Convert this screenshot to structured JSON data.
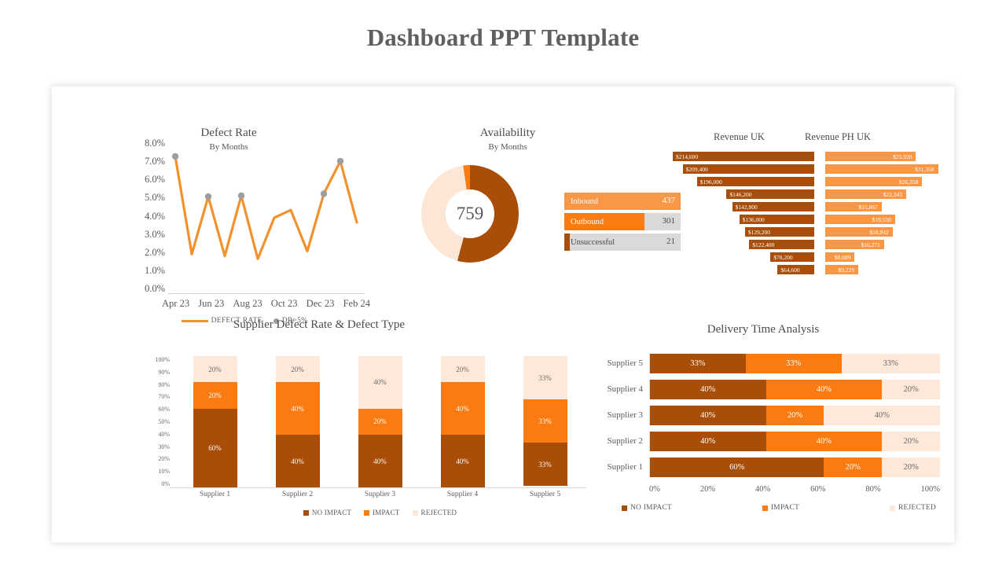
{
  "page": {
    "title": "Dashboard PPT Template"
  },
  "colors": {
    "dark_orange": "#a84e08",
    "orange": "#f97b11",
    "light_orange": "#f99746",
    "pale_orange": "#fde8d9",
    "grey": "#d9d9d9",
    "title_grey": "#5f5f5f"
  },
  "defect_rate": {
    "title": "Defect Rate",
    "subtitle": "By Months",
    "legend": [
      {
        "label": "DEFECT RATE",
        "type": "line",
        "color": "#f2922f"
      },
      {
        "label": "DR>5%",
        "type": "dot",
        "color": "#9e9e9e"
      }
    ],
    "chart_data": {
      "type": "line",
      "title": "Defect Rate",
      "subtitle": "By Months",
      "xlabel": "",
      "ylabel": "",
      "ylim": [
        0,
        8
      ],
      "yticks": [
        "0.0%",
        "1.0%",
        "2.0%",
        "3.0%",
        "4.0%",
        "5.0%",
        "6.0%",
        "7.0%",
        "8.0%"
      ],
      "xticks": [
        "Apr 23",
        "Jun 23",
        "Aug 23",
        "Oct 23",
        "Dec 23",
        "Feb 24"
      ],
      "x": [
        "Apr 23",
        "May 23",
        "Jun 23",
        "Jul 23",
        "Aug 23",
        "Sep 23",
        "Oct 23",
        "Nov 23",
        "Dec 23",
        "Jan 24",
        "Feb 24",
        "Mar 24"
      ],
      "series": [
        {
          "name": "DEFECT RATE",
          "color": "#f2922f",
          "values": [
            7.1,
            2.0,
            5.0,
            1.9,
            5.05,
            1.75,
            3.9,
            4.3,
            2.15,
            5.15,
            6.85,
            3.65
          ]
        },
        {
          "name": "DR>5%",
          "color": "#9e9e9e",
          "type": "marker",
          "points": [
            {
              "x": "Apr 23",
              "y": 7.1
            },
            {
              "x": "Jun 23",
              "y": 5.0
            },
            {
              "x": "Aug 23",
              "y": 5.05
            },
            {
              "x": "Jan 24",
              "y": 5.15
            },
            {
              "x": "Feb 24",
              "y": 6.85
            }
          ]
        }
      ],
      "grid": false,
      "legend_position": "bottom"
    }
  },
  "availability": {
    "title": "Availability",
    "subtitle": "By Months",
    "center_value": "759",
    "chart_data": {
      "type": "pie",
      "title": "Availability",
      "subtitle": "By Months",
      "center_label": "759",
      "labels": [
        "Inbound",
        "Outbound",
        "Unsuccessful"
      ],
      "values": [
        437,
        301,
        21
      ],
      "colors": [
        "#fce6d6",
        "#f97b11",
        "#a84e08"
      ],
      "legend_position": "right"
    },
    "legend": [
      {
        "label": "Inbound",
        "value": "437",
        "color": "#f99746",
        "fill_pct": 100,
        "text_on_fill": true
      },
      {
        "label": "Outbound",
        "value": "301",
        "color": "#f97b11",
        "fill_pct": 69,
        "text_on_fill": false
      },
      {
        "label": "Unsuccessful",
        "value": "21",
        "color": "#a84e08",
        "fill_pct": 5,
        "text_on_fill": false
      }
    ]
  },
  "revenue": {
    "uk_title": "Revenue UK",
    "ph_title": "Revenue PH UK",
    "chart_data": [
      {
        "type": "bar",
        "title": "Revenue UK",
        "orientation": "horizontal",
        "color": "#a84e08",
        "categories": [
          "1",
          "2",
          "3",
          "4",
          "5",
          "6",
          "7",
          "8",
          "9",
          "10"
        ],
        "labels": [
          "$214,600",
          "$209,400",
          "$196,000",
          "$146,200",
          "$142,800",
          "$136,000",
          "$129,200",
          "$122,400",
          "$78,200",
          "$64,600"
        ],
        "values": [
          214600,
          209400,
          196000,
          146200,
          142800,
          136000,
          129200,
          122400,
          78200,
          64600
        ]
      },
      {
        "type": "bar",
        "title": "Revenue PH UK",
        "orientation": "horizontal",
        "color": "#f99746",
        "categories": [
          "1",
          "2",
          "3",
          "4",
          "5",
          "6",
          "7",
          "8",
          "9",
          "10"
        ],
        "labels": [
          "$25,928",
          "$31,358",
          "$26,358",
          "$22,343",
          "$15,867",
          "$19,550",
          "$18,842",
          "$16,271",
          "$8,689",
          "$9,229"
        ],
        "values": [
          25928,
          31358,
          26358,
          22343,
          15867,
          19550,
          18842,
          16271,
          8689,
          9229
        ]
      }
    ],
    "uk_rows": [
      {
        "label": "$214,600",
        "width_pct": 100
      },
      {
        "label": "$209,400",
        "width_pct": 93
      },
      {
        "label": "$196,000",
        "width_pct": 83
      },
      {
        "label": "$146,200",
        "width_pct": 62
      },
      {
        "label": "$142,800",
        "width_pct": 58
      },
      {
        "label": "$136,000",
        "width_pct": 53
      },
      {
        "label": "$129,200",
        "width_pct": 49
      },
      {
        "label": "$122,400",
        "width_pct": 46
      },
      {
        "label": "$78,200",
        "width_pct": 31
      },
      {
        "label": "$64,600",
        "width_pct": 26
      }
    ],
    "ph_rows": [
      {
        "label": "$25,928",
        "width_pct": 74
      },
      {
        "label": "$31,358",
        "width_pct": 92
      },
      {
        "label": "$26,358",
        "width_pct": 79
      },
      {
        "label": "$22,343",
        "width_pct": 66
      },
      {
        "label": "$15,867",
        "width_pct": 46
      },
      {
        "label": "$19,550",
        "width_pct": 57
      },
      {
        "label": "$18,842",
        "width_pct": 55
      },
      {
        "label": "$16,271",
        "width_pct": 48
      },
      {
        "label": "$8,689",
        "width_pct": 24
      },
      {
        "label": "$9,229",
        "width_pct": 27
      }
    ]
  },
  "supplier_defect": {
    "title": "Supplier Defect Rate & Defect Type",
    "yticks": [
      "100%",
      "90%",
      "80%",
      "70%",
      "60%",
      "50%",
      "40%",
      "30%",
      "20%",
      "10%",
      "0%"
    ],
    "legend": [
      {
        "label": "NO IMPACT",
        "color": "#a84e08"
      },
      {
        "label": "IMPACT",
        "color": "#f97b11"
      },
      {
        "label": "REJECTED",
        "color": "#fde8d9"
      }
    ],
    "chart_data": {
      "type": "bar",
      "title": "Supplier Defect Rate & Defect Type",
      "stacked": true,
      "orientation": "vertical",
      "categories": [
        "Supplier 1",
        "Supplier 2",
        "Supplier 3",
        "Supplier 4",
        "Supplier 5"
      ],
      "ylim": [
        0,
        100
      ],
      "yticks": [
        0,
        10,
        20,
        30,
        40,
        50,
        60,
        70,
        80,
        90,
        100
      ],
      "ylabel": "",
      "series": [
        {
          "name": "NO IMPACT",
          "color": "#a84e08",
          "values": [
            60,
            40,
            40,
            40,
            33
          ]
        },
        {
          "name": "IMPACT",
          "color": "#f97b11",
          "values": [
            20,
            40,
            20,
            40,
            33
          ]
        },
        {
          "name": "REJECTED",
          "color": "#fde8d9",
          "values": [
            20,
            20,
            40,
            20,
            33
          ]
        }
      ],
      "legend_position": "bottom"
    },
    "columns": [
      {
        "name": "Supplier 1",
        "rejected": "20%",
        "impact": "20%",
        "noimpact": "60%",
        "rejected_v": 20,
        "impact_v": 20,
        "noimpact_v": 60
      },
      {
        "name": "Supplier 2",
        "rejected": "20%",
        "impact": "40%",
        "noimpact": "40%",
        "rejected_v": 20,
        "impact_v": 40,
        "noimpact_v": 40
      },
      {
        "name": "Supplier 3",
        "rejected": "40%",
        "impact": "20%",
        "noimpact": "40%",
        "rejected_v": 40,
        "impact_v": 20,
        "noimpact_v": 40
      },
      {
        "name": "Supplier 4",
        "rejected": "20%",
        "impact": "40%",
        "noimpact": "40%",
        "rejected_v": 20,
        "impact_v": 40,
        "noimpact_v": 40
      },
      {
        "name": "Supplier 5",
        "rejected": "33%",
        "impact": "33%",
        "noimpact": "33%",
        "rejected_v": 33,
        "impact_v": 33,
        "noimpact_v": 33
      }
    ]
  },
  "delivery": {
    "title": "Delivery Time Analysis",
    "xticks": [
      "0%",
      "20%",
      "40%",
      "60%",
      "80%",
      "100%"
    ],
    "legend": [
      {
        "label": "NO IMPACT",
        "color": "#a84e08"
      },
      {
        "label": "IMPACT",
        "color": "#f97b11"
      },
      {
        "label": "REJECTED",
        "color": "#fde8d9"
      }
    ],
    "chart_data": {
      "type": "bar",
      "title": "Delivery Time Analysis",
      "stacked": true,
      "orientation": "horizontal",
      "categories": [
        "Supplier 5",
        "Supplier 4",
        "Supplier 3",
        "Supplier 2",
        "Supplier 1"
      ],
      "xlim": [
        0,
        100
      ],
      "xticks": [
        0,
        20,
        40,
        60,
        80,
        100
      ],
      "series": [
        {
          "name": "NO IMPACT",
          "color": "#a84e08",
          "values": [
            33,
            40,
            40,
            40,
            60
          ]
        },
        {
          "name": "IMPACT",
          "color": "#f97b11",
          "values": [
            33,
            40,
            20,
            40,
            20
          ]
        },
        {
          "name": "REJECTED",
          "color": "#fde8d9",
          "values": [
            33,
            20,
            40,
            20,
            20
          ]
        }
      ],
      "legend_position": "bottom"
    },
    "rows": [
      {
        "name": "Supplier 5",
        "noimpact": "33%",
        "impact": "33%",
        "rejected": "33%",
        "noimpact_v": 33,
        "impact_v": 33,
        "rejected_v": 34
      },
      {
        "name": "Supplier 4",
        "noimpact": "40%",
        "impact": "40%",
        "rejected": "20%",
        "noimpact_v": 40,
        "impact_v": 40,
        "rejected_v": 20
      },
      {
        "name": "Supplier 3",
        "noimpact": "40%",
        "impact": "20%",
        "rejected": "40%",
        "noimpact_v": 40,
        "impact_v": 20,
        "rejected_v": 40
      },
      {
        "name": "Supplier 2",
        "noimpact": "40%",
        "impact": "40%",
        "rejected": "20%",
        "noimpact_v": 40,
        "impact_v": 40,
        "rejected_v": 20
      },
      {
        "name": "Supplier 1",
        "noimpact": "60%",
        "impact": "20%",
        "rejected": "20%",
        "noimpact_v": 60,
        "impact_v": 20,
        "rejected_v": 20
      }
    ]
  }
}
